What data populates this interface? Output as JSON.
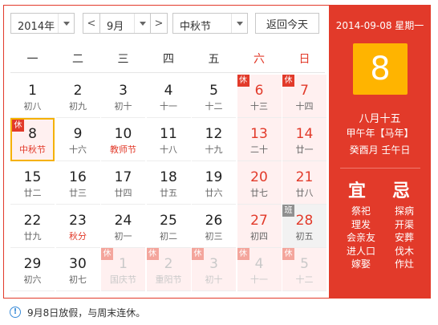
{
  "toolbar": {
    "year": "2014年",
    "prev": "<",
    "month": "9月",
    "next": ">",
    "holiday": "中秋节",
    "today": "返回今天"
  },
  "weekdays": [
    "一",
    "二",
    "三",
    "四",
    "五",
    "六",
    "日"
  ],
  "days": [
    {
      "num": "1",
      "sub": "初八"
    },
    {
      "num": "2",
      "sub": "初九"
    },
    {
      "num": "3",
      "sub": "初十"
    },
    {
      "num": "4",
      "sub": "十一"
    },
    {
      "num": "5",
      "sub": "十二"
    },
    {
      "num": "6",
      "sub": "十三",
      "weekend": true,
      "badge": "休"
    },
    {
      "num": "7",
      "sub": "十四",
      "weekend": true,
      "badge": "休"
    },
    {
      "num": "8",
      "sub": "中秋节",
      "festival": true,
      "badge": "休",
      "selected": true
    },
    {
      "num": "9",
      "sub": "十六"
    },
    {
      "num": "10",
      "sub": "教师节",
      "festival": true
    },
    {
      "num": "11",
      "sub": "十八"
    },
    {
      "num": "12",
      "sub": "十九"
    },
    {
      "num": "13",
      "sub": "二十",
      "weekend": true
    },
    {
      "num": "14",
      "sub": "廿一",
      "weekend": true
    },
    {
      "num": "15",
      "sub": "廿二"
    },
    {
      "num": "16",
      "sub": "廿三"
    },
    {
      "num": "17",
      "sub": "廿四"
    },
    {
      "num": "18",
      "sub": "廿五"
    },
    {
      "num": "19",
      "sub": "廿六"
    },
    {
      "num": "20",
      "sub": "廿七",
      "weekend": true
    },
    {
      "num": "21",
      "sub": "廿八",
      "weekend": true
    },
    {
      "num": "22",
      "sub": "廿九"
    },
    {
      "num": "23",
      "sub": "秋分",
      "festival": true
    },
    {
      "num": "24",
      "sub": "初一"
    },
    {
      "num": "25",
      "sub": "初二"
    },
    {
      "num": "26",
      "sub": "初三"
    },
    {
      "num": "27",
      "sub": "初四",
      "weekend": true
    },
    {
      "num": "28",
      "sub": "初五",
      "weekend": true,
      "badge": "班",
      "work": true
    },
    {
      "num": "29",
      "sub": "初六"
    },
    {
      "num": "30",
      "sub": "初七"
    },
    {
      "num": "1",
      "sub": "国庆节",
      "other": true,
      "badge": "休"
    },
    {
      "num": "2",
      "sub": "重阳节",
      "other": true,
      "badge": "休"
    },
    {
      "num": "3",
      "sub": "初十",
      "other": true,
      "badge": "休"
    },
    {
      "num": "4",
      "sub": "十一",
      "other": true,
      "badge": "休",
      "weekend": true
    },
    {
      "num": "5",
      "sub": "十二",
      "other": true,
      "badge": "休",
      "weekend": true
    }
  ],
  "panel": {
    "date": "2014-09-08 星期一",
    "day": "8",
    "lunar": "八月十五",
    "ganzhi1": "甲午年【马年】",
    "ganzhi2": "癸酉月 壬午日",
    "yi_title": "宜",
    "ji_title": "忌",
    "yi": [
      "祭祀",
      "理发",
      "会亲友",
      "进人口",
      "嫁娶"
    ],
    "ji": [
      "探病",
      "开渠",
      "安葬",
      "伐木",
      "作灶"
    ]
  },
  "footer": {
    "info_icon": "!",
    "text": "9月8日放假，与周末连休。"
  },
  "colors": {
    "accent": "#e23a2a",
    "highlight": "#ffb400",
    "holiday_bg": "#fff0f0"
  }
}
